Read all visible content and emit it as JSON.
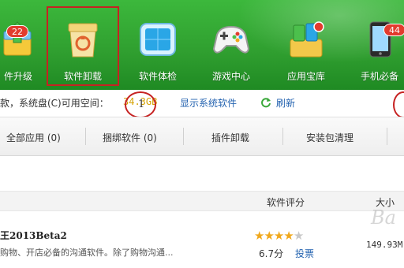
{
  "toolbar": {
    "items": [
      {
        "label": "件升级",
        "badge": "22",
        "icon": "upgrade-icon"
      },
      {
        "label": "软件卸载",
        "icon": "uninstall-box-icon",
        "selected": true
      },
      {
        "label": "软件体检",
        "icon": "checkup-screen-icon"
      },
      {
        "label": "游戏中心",
        "icon": "gamepad-icon"
      },
      {
        "label": "应用宝库",
        "icon": "app-store-box-icon"
      },
      {
        "label": "手机必备",
        "badge": "44",
        "icon": "phone-icon"
      }
    ],
    "selection_color": "#c62222"
  },
  "status": {
    "text": "款，系统盘(C)可用空间：",
    "free_space": "34.3GB",
    "show_system": "显示系统软件",
    "refresh": "刷新"
  },
  "annotations": {
    "circle1_label": "1"
  },
  "tabs": [
    {
      "label": "全部应用 (0)"
    },
    {
      "label": "捆绑软件 (0)"
    },
    {
      "label": "插件卸载"
    },
    {
      "label": "安装包清理"
    }
  ],
  "list": {
    "headers": {
      "rating": "软件评分",
      "size": "大小"
    },
    "rows": [
      {
        "name": "王2013Beta2",
        "desc": "购物、开店必备的沟通软件。除了购物沟通...",
        "stars_on": 4,
        "stars_total": 5,
        "score": "6.7分",
        "vote": "投票",
        "size": "149.93M"
      }
    ]
  },
  "colors": {
    "toolbar_green": "#2f9e2f",
    "link_blue": "#2463b0",
    "star_gold": "#f0a81c"
  }
}
